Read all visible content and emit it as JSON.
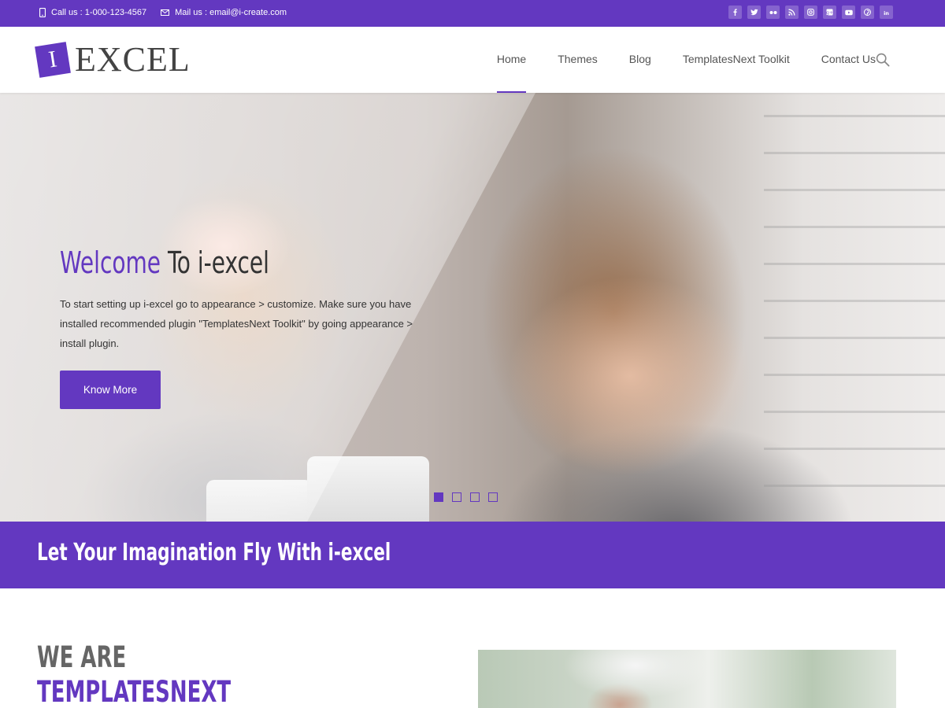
{
  "topbar": {
    "phone_text": "Call us : 1-000-123-4567",
    "mail_text": "Mail us : email@i-create.com",
    "socials": [
      "facebook-icon",
      "twitter-icon",
      "flickr-icon",
      "rss-icon",
      "instagram-icon",
      "google-plus-icon",
      "youtube-icon",
      "pinterest-icon",
      "linkedin-icon"
    ]
  },
  "header": {
    "logo_mark": "I",
    "logo_word": "EXCEL",
    "nav": [
      {
        "label": "Home",
        "active": true
      },
      {
        "label": "Themes"
      },
      {
        "label": "Blog"
      },
      {
        "label": "TemplatesNext Toolkit"
      },
      {
        "label": "Contact Us"
      }
    ]
  },
  "hero": {
    "title_highlight": "Welcome",
    "title_rest": " To i-excel",
    "text": "To start setting up i-excel go to appearance > customize. Make sure you have installed recommended plugin \"TemplatesNext Toolkit\" by going appearance > install plugin.",
    "button_label": "Know More",
    "slides": 4,
    "active_slide": 1
  },
  "band": {
    "title": "Let Your Imagination Fly With i-excel"
  },
  "about": {
    "heading_line1": "WE ARE",
    "heading_line2": "TEMPLATESNEXT"
  },
  "colors": {
    "accent": "#6338c0"
  }
}
